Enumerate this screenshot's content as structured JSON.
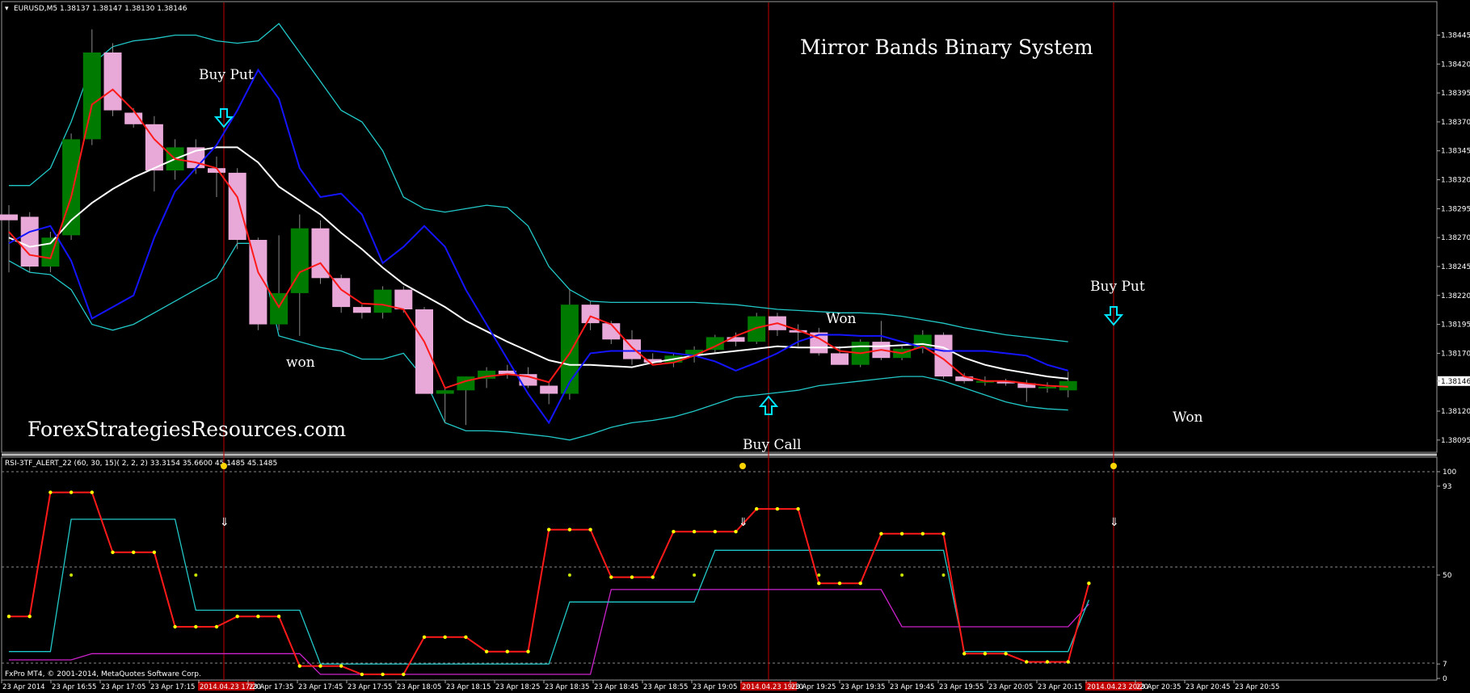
{
  "window": {
    "symbol_header": "EURUSD,M5  1.38137 1.38147 1.38130 1.38146",
    "indicator_header": "RSI-3TF_ALERT_22  (60, 30, 15)( 2, 2, 2)  33.3154 35.6600 45.1485 45.1485",
    "copyright": "FxPro MT4, © 2001-2014, MetaQuotes Software Corp."
  },
  "annotations": {
    "title": "Mirror Bands Binary System",
    "watermark": "ForexStrategiesResources.com",
    "buy_put_1": "Buy Put",
    "buy_put_2": "Buy Put",
    "buy_call": "Buy Call",
    "won_1": "won",
    "won_2": "Won",
    "won_3": "Won"
  },
  "colors": {
    "background": "#000000",
    "bull": "#007a00",
    "bear": "#e8a8d8",
    "band": "#22c8c8",
    "mid_band": "#ffffff",
    "fast_ma": "#ff1a1a",
    "mirror": "#1414ff",
    "vline": "#c00000",
    "rsi_red": "#ff1a1a",
    "rsi_cyan": "#22c8c8",
    "rsi_magenta": "#cc22cc",
    "dot": "#ffff00",
    "arrow": "#00e5ff"
  },
  "chart_data": [
    {
      "type": "candlestick",
      "symbol": "EURUSD",
      "timeframe": "M5",
      "last_price": "1.38146",
      "y_ticks": [
        "1.38445",
        "1.38420",
        "1.38395",
        "1.38370",
        "1.38345",
        "1.38320",
        "1.38295",
        "1.38270",
        "1.38245",
        "1.38220",
        "1.38195",
        "1.38170",
        "1.38146",
        "1.38120",
        "1.38095"
      ],
      "ylim": [
        1.3809,
        1.3846
      ],
      "candles": [
        {
          "o": 1.3829,
          "h": 1.38298,
          "l": 1.3824,
          "c": 1.38285
        },
        {
          "o": 1.38288,
          "h": 1.38292,
          "l": 1.3824,
          "c": 1.38245
        },
        {
          "o": 1.38245,
          "h": 1.38275,
          "l": 1.3824,
          "c": 1.3827
        },
        {
          "o": 1.38272,
          "h": 1.3836,
          "l": 1.38268,
          "c": 1.38355
        },
        {
          "o": 1.38355,
          "h": 1.3845,
          "l": 1.3835,
          "c": 1.3843
        },
        {
          "o": 1.3843,
          "h": 1.38438,
          "l": 1.38375,
          "c": 1.3838
        },
        {
          "o": 1.38378,
          "h": 1.38382,
          "l": 1.38365,
          "c": 1.38368
        },
        {
          "o": 1.38368,
          "h": 1.38375,
          "l": 1.3831,
          "c": 1.38328
        },
        {
          "o": 1.38328,
          "h": 1.38355,
          "l": 1.3832,
          "c": 1.38348
        },
        {
          "o": 1.38348,
          "h": 1.38355,
          "l": 1.38325,
          "c": 1.3833
        },
        {
          "o": 1.3833,
          "h": 1.3834,
          "l": 1.38305,
          "c": 1.38326
        },
        {
          "o": 1.38326,
          "h": 1.3833,
          "l": 1.3826,
          "c": 1.38268
        },
        {
          "o": 1.38268,
          "h": 1.3827,
          "l": 1.3819,
          "c": 1.38195
        },
        {
          "o": 1.38195,
          "h": 1.38272,
          "l": 1.3819,
          "c": 1.38222
        },
        {
          "o": 1.38222,
          "h": 1.3829,
          "l": 1.38185,
          "c": 1.38278
        },
        {
          "o": 1.38278,
          "h": 1.38285,
          "l": 1.3823,
          "c": 1.38235
        },
        {
          "o": 1.38235,
          "h": 1.38238,
          "l": 1.38205,
          "c": 1.3821
        },
        {
          "o": 1.3821,
          "h": 1.38212,
          "l": 1.382,
          "c": 1.38205
        },
        {
          "o": 1.38205,
          "h": 1.38228,
          "l": 1.382,
          "c": 1.38225
        },
        {
          "o": 1.38225,
          "h": 1.38228,
          "l": 1.38205,
          "c": 1.38208
        },
        {
          "o": 1.38208,
          "h": 1.3821,
          "l": 1.38135,
          "c": 1.38135
        },
        {
          "o": 1.38135,
          "h": 1.3814,
          "l": 1.3811,
          "c": 1.38138
        },
        {
          "o": 1.38138,
          "h": 1.3815,
          "l": 1.38108,
          "c": 1.3815
        },
        {
          "o": 1.38148,
          "h": 1.38158,
          "l": 1.3814,
          "c": 1.38155
        },
        {
          "o": 1.38155,
          "h": 1.3816,
          "l": 1.38148,
          "c": 1.38152
        },
        {
          "o": 1.38152,
          "h": 1.38158,
          "l": 1.3814,
          "c": 1.38142
        },
        {
          "o": 1.38142,
          "h": 1.38145,
          "l": 1.38126,
          "c": 1.38135
        },
        {
          "o": 1.38135,
          "h": 1.38225,
          "l": 1.3813,
          "c": 1.38212
        },
        {
          "o": 1.38212,
          "h": 1.38215,
          "l": 1.3819,
          "c": 1.38196
        },
        {
          "o": 1.38196,
          "h": 1.38198,
          "l": 1.38178,
          "c": 1.38182
        },
        {
          "o": 1.38182,
          "h": 1.3819,
          "l": 1.3816,
          "c": 1.38165
        },
        {
          "o": 1.38165,
          "h": 1.3817,
          "l": 1.3816,
          "c": 1.38162
        },
        {
          "o": 1.38162,
          "h": 1.3817,
          "l": 1.38158,
          "c": 1.38168
        },
        {
          "o": 1.38168,
          "h": 1.38176,
          "l": 1.38162,
          "c": 1.38173
        },
        {
          "o": 1.38173,
          "h": 1.38186,
          "l": 1.3817,
          "c": 1.38184
        },
        {
          "o": 1.38184,
          "h": 1.38188,
          "l": 1.38176,
          "c": 1.3818
        },
        {
          "o": 1.3818,
          "h": 1.38205,
          "l": 1.38178,
          "c": 1.38202
        },
        {
          "o": 1.38202,
          "h": 1.38205,
          "l": 1.38185,
          "c": 1.3819
        },
        {
          "o": 1.3819,
          "h": 1.38195,
          "l": 1.38176,
          "c": 1.38188
        },
        {
          "o": 1.38188,
          "h": 1.38192,
          "l": 1.38168,
          "c": 1.3817
        },
        {
          "o": 1.3817,
          "h": 1.38176,
          "l": 1.3816,
          "c": 1.3816
        },
        {
          "o": 1.3816,
          "h": 1.38182,
          "l": 1.38158,
          "c": 1.3818
        },
        {
          "o": 1.3818,
          "h": 1.38198,
          "l": 1.38164,
          "c": 1.38166
        },
        {
          "o": 1.38166,
          "h": 1.38176,
          "l": 1.38164,
          "c": 1.38174
        },
        {
          "o": 1.38174,
          "h": 1.3819,
          "l": 1.3817,
          "c": 1.38186
        },
        {
          "o": 1.38186,
          "h": 1.38188,
          "l": 1.38148,
          "c": 1.3815
        },
        {
          "o": 1.3815,
          "h": 1.38153,
          "l": 1.38144,
          "c": 1.38146
        },
        {
          "o": 1.38146,
          "h": 1.3815,
          "l": 1.38142,
          "c": 1.38146
        },
        {
          "o": 1.38146,
          "h": 1.38148,
          "l": 1.38142,
          "c": 1.38144
        },
        {
          "o": 1.38144,
          "h": 1.38147,
          "l": 1.38128,
          "c": 1.3814
        },
        {
          "o": 1.3814,
          "h": 1.38145,
          "l": 1.38136,
          "c": 1.38141
        },
        {
          "o": 1.38138,
          "h": 1.38154,
          "l": 1.38132,
          "c": 1.38146
        }
      ],
      "upper_band": [
        1.38315,
        1.38315,
        1.3833,
        1.3837,
        1.3842,
        1.38435,
        1.3844,
        1.38442,
        1.38445,
        1.38445,
        1.3844,
        1.38438,
        1.3844,
        1.38455,
        1.3843,
        1.38405,
        1.3838,
        1.3837,
        1.38345,
        1.38305,
        1.38295,
        1.38292,
        1.38295,
        1.38298,
        1.38296,
        1.3828,
        1.38245,
        1.38225,
        1.38215,
        1.38214,
        1.38214,
        1.38214,
        1.38214,
        1.38214,
        1.38213,
        1.38212,
        1.3821,
        1.38208,
        1.38207,
        1.38206,
        1.38205,
        1.38205,
        1.38204,
        1.38202,
        1.38199,
        1.38196,
        1.38192,
        1.38189,
        1.38186,
        1.38184,
        1.38182,
        1.3818
      ],
      "lower_band": [
        1.3825,
        1.3824,
        1.38238,
        1.38225,
        1.38195,
        1.3819,
        1.38195,
        1.38205,
        1.38215,
        1.38225,
        1.38235,
        1.38265,
        1.38265,
        1.38185,
        1.3818,
        1.38175,
        1.38172,
        1.38165,
        1.38165,
        1.3817,
        1.38148,
        1.3811,
        1.38103,
        1.38103,
        1.38102,
        1.381,
        1.38098,
        1.38095,
        1.381,
        1.38106,
        1.3811,
        1.38112,
        1.38115,
        1.3812,
        1.38126,
        1.38132,
        1.38134,
        1.38136,
        1.38138,
        1.38142,
        1.38144,
        1.38146,
        1.38148,
        1.3815,
        1.3815,
        1.38146,
        1.3814,
        1.38134,
        1.38128,
        1.38124,
        1.38122,
        1.38121
      ],
      "mid_band": [
        1.3827,
        1.38262,
        1.38265,
        1.38285,
        1.383,
        1.38312,
        1.38322,
        1.3833,
        1.38338,
        1.38345,
        1.38348,
        1.38348,
        1.38335,
        1.38314,
        1.38302,
        1.3829,
        1.38274,
        1.3826,
        1.38244,
        1.3823,
        1.3822,
        1.3821,
        1.38198,
        1.38189,
        1.3818,
        1.38172,
        1.38164,
        1.3816,
        1.3816,
        1.38159,
        1.38158,
        1.38162,
        1.38165,
        1.38168,
        1.3817,
        1.38172,
        1.38174,
        1.38176,
        1.38175,
        1.38175,
        1.38175,
        1.38176,
        1.38176,
        1.38177,
        1.38178,
        1.38175,
        1.38166,
        1.3816,
        1.38156,
        1.38153,
        1.3815,
        1.38148
      ],
      "fast_ma": [
        1.38275,
        1.38255,
        1.38252,
        1.38305,
        1.38385,
        1.38398,
        1.3838,
        1.38355,
        1.38338,
        1.38335,
        1.3833,
        1.38305,
        1.3824,
        1.3821,
        1.3824,
        1.38248,
        1.38225,
        1.38213,
        1.38212,
        1.38208,
        1.3818,
        1.3814,
        1.38146,
        1.3815,
        1.38152,
        1.3815,
        1.38145,
        1.3817,
        1.38202,
        1.38195,
        1.38175,
        1.3816,
        1.38162,
        1.38168,
        1.38176,
        1.38185,
        1.38192,
        1.38196,
        1.3819,
        1.38183,
        1.38172,
        1.3817,
        1.38173,
        1.3817,
        1.38176,
        1.38165,
        1.3815,
        1.38146,
        1.38146,
        1.38144,
        1.38142,
        1.38141
      ],
      "mirror_line": [
        1.38265,
        1.38275,
        1.3828,
        1.3825,
        1.382,
        1.3821,
        1.3822,
        1.3827,
        1.3831,
        1.3833,
        1.3835,
        1.3838,
        1.38415,
        1.3839,
        1.3833,
        1.38305,
        1.38308,
        1.3829,
        1.38248,
        1.38262,
        1.3828,
        1.38262,
        1.38225,
        1.38195,
        1.38165,
        1.38135,
        1.3811,
        1.38145,
        1.3817,
        1.38172,
        1.38172,
        1.38172,
        1.3817,
        1.38168,
        1.38163,
        1.38155,
        1.38162,
        1.3817,
        1.3818,
        1.38186,
        1.38186,
        1.38185,
        1.38185,
        1.3818,
        1.38175,
        1.38172,
        1.38172,
        1.38172,
        1.3817,
        1.38168,
        1.3816,
        1.38155
      ]
    },
    {
      "type": "line",
      "name": "RSI-3TF_ALERT_22",
      "y_ticks": [
        "100",
        "93",
        "50",
        "7",
        "0"
      ],
      "ylim": [
        0,
        100
      ],
      "red_line": [
        30,
        30,
        90,
        90,
        90,
        61,
        61,
        61,
        25,
        25,
        25,
        30,
        30,
        30,
        6,
        6,
        6,
        2,
        2,
        2,
        20,
        20,
        20,
        13,
        13,
        13,
        72,
        72,
        72,
        49,
        49,
        49,
        71,
        71,
        71,
        71,
        82,
        82,
        82,
        46,
        46,
        46,
        70,
        70,
        70,
        70,
        12,
        12,
        12,
        8,
        8,
        8,
        46
      ],
      "cyan_line": [
        13,
        13,
        13,
        77,
        77,
        77,
        77,
        77,
        77,
        33,
        33,
        33,
        33,
        33,
        33,
        7,
        7,
        7,
        7,
        7,
        7,
        7,
        7,
        7,
        7,
        7,
        7,
        37,
        37,
        37,
        37,
        37,
        37,
        37,
        62,
        62,
        62,
        62,
        62,
        62,
        62,
        62,
        62,
        62,
        62,
        62,
        13,
        13,
        13,
        13,
        13,
        13,
        38
      ],
      "magenta_line": [
        9,
        9,
        9,
        9,
        12,
        12,
        12,
        12,
        12,
        12,
        12,
        12,
        12,
        12,
        12,
        2,
        2,
        2,
        2,
        2,
        2,
        2,
        2,
        2,
        2,
        2,
        2,
        2,
        2,
        43,
        43,
        43,
        43,
        43,
        43,
        43,
        43,
        43,
        43,
        43,
        43,
        43,
        43,
        25,
        25,
        25,
        25,
        25,
        25,
        25,
        25,
        25,
        36
      ]
    }
  ],
  "time_axis": {
    "labels": [
      "23 Apr 2014",
      "23 Apr 16:55",
      "23 Apr 17:05",
      "23 Apr 17:15",
      "2014.04.23 17:20",
      "23 Apr 17:35",
      "23 Apr 17:45",
      "23 Apr 17:55",
      "23 Apr 18:05",
      "23 Apr 18:15",
      "23 Apr 18:25",
      "23 Apr 18:35",
      "23 Apr 18:45",
      "23 Apr 18:55",
      "23 Apr 19:05",
      "2014.04.23 19:10",
      "23 Apr 19:25",
      "23 Apr 19:35",
      "23 Apr 19:45",
      "23 Apr 19:55",
      "23 Apr 20:05",
      "23 Apr 20:15",
      "2014.04.23 20:20",
      "23 Apr 20:35",
      "23 Apr 20:45",
      "23 Apr 20:55"
    ]
  }
}
